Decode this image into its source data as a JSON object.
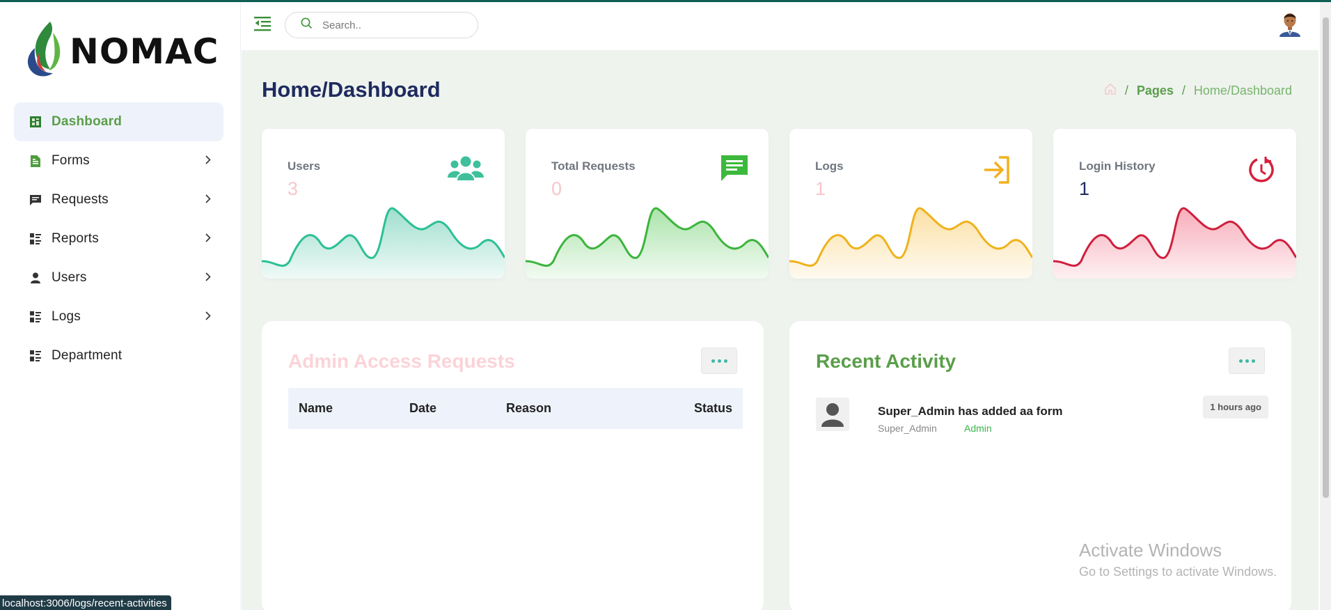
{
  "brand": {
    "name": "NOMAC"
  },
  "sidebar": {
    "items": [
      {
        "label": "Dashboard",
        "icon": "dashboard-icon",
        "active": true,
        "has_children": false
      },
      {
        "label": "Forms",
        "icon": "form-icon",
        "active": false,
        "has_children": true
      },
      {
        "label": "Requests",
        "icon": "message-icon",
        "active": false,
        "has_children": true
      },
      {
        "label": "Reports",
        "icon": "report-list-icon",
        "active": false,
        "has_children": true
      },
      {
        "label": "Users",
        "icon": "user-icon",
        "active": false,
        "has_children": true
      },
      {
        "label": "Logs",
        "icon": "log-list-icon",
        "active": false,
        "has_children": true
      },
      {
        "label": "Department",
        "icon": "department-list-icon",
        "active": false,
        "has_children": false
      }
    ]
  },
  "topbar": {
    "search_placeholder": "Search.."
  },
  "page": {
    "title": "Home/Dashboard"
  },
  "breadcrumb": {
    "pages": "Pages",
    "current": "Home/Dashboard"
  },
  "stats": [
    {
      "label": "Users",
      "value": "3",
      "icon": "users-group-icon",
      "color": "#3fbf9b",
      "value_color": "#f7c6cc"
    },
    {
      "label": "Total Requests",
      "value": "0",
      "icon": "chat-bubble-icon",
      "color": "#3cb93c",
      "value_color": "#f7c6cc"
    },
    {
      "label": "Logs",
      "value": "1",
      "icon": "login-arrow-icon",
      "color": "#f2b01e",
      "value_color": "#f7c6cc"
    },
    {
      "label": "Login History",
      "value": "1",
      "icon": "history-icon",
      "color": "#d61f3c",
      "value_color": "#1e2a5e"
    }
  ],
  "admin_requests": {
    "title": "Admin Access Requests",
    "columns": [
      "Name",
      "Date",
      "Reason",
      "Status"
    ]
  },
  "recent_activity": {
    "title": "Recent Activity",
    "items": [
      {
        "text": "Super_Admin has added aa form",
        "user": "Super_Admin",
        "role": "Admin",
        "time": "1 hours ago"
      }
    ]
  },
  "watermark": {
    "line1": "Activate Windows",
    "line2": "Go to Settings to activate Windows."
  },
  "status_bar": {
    "url": "localhost:3006/logs/recent-activities"
  },
  "colors": {
    "accent_green": "#5a9e4a",
    "title_navy": "#1e2a5e",
    "pink_title": "#fbd3d8"
  }
}
